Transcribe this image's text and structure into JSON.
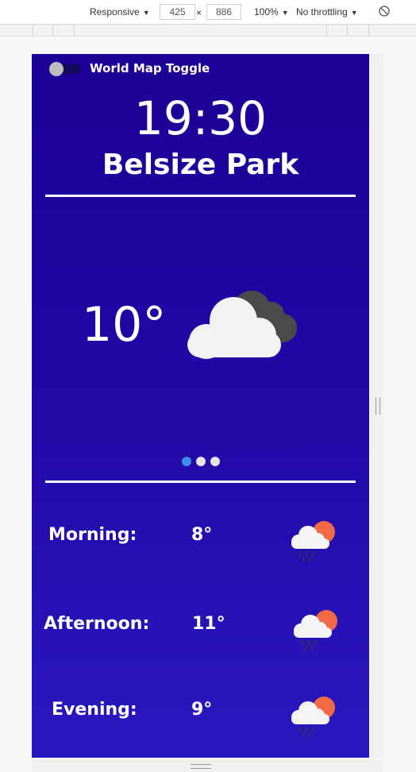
{
  "devtools": {
    "device_mode": "Responsive",
    "width": "425",
    "times": "×",
    "height": "886",
    "zoom": "100%",
    "throttling": "No throttling"
  },
  "app": {
    "toggle_label": "World Map Toggle",
    "toggle_on": false,
    "time": "19:30",
    "location": "Belsize Park",
    "current_temp": "10°",
    "current_icon": "cloudy-icon",
    "carousel": {
      "count": 3,
      "active_index": 0
    },
    "forecast": [
      {
        "period": "Morning:",
        "temp": "8°",
        "icon": "rain-sun-cloud-icon"
      },
      {
        "period": "Afternoon:",
        "temp": "11°",
        "icon": "rain-sun-cloud-icon"
      },
      {
        "period": "Evening:",
        "temp": "9°",
        "icon": "rain-sun-cloud-icon"
      }
    ]
  },
  "colors": {
    "background_top": "#1d0095",
    "background_bottom": "#2a18bf",
    "text": "#ffffff",
    "dot_active": "#3a8ee6",
    "dot_inactive": "#e6e6e6",
    "sun": "#f06a45"
  }
}
